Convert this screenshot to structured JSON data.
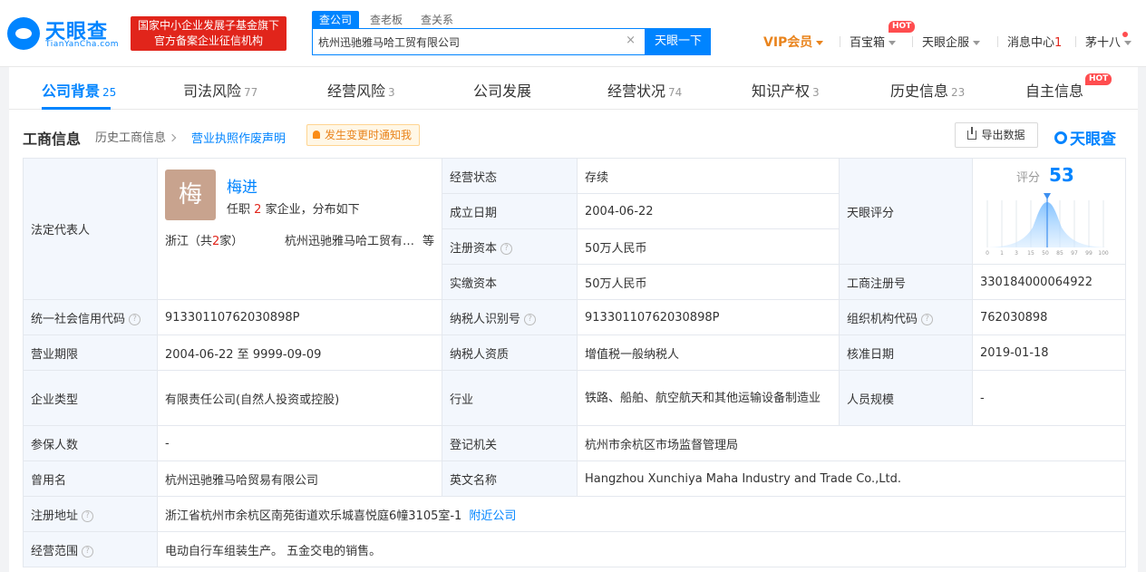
{
  "header": {
    "logo_text": "天眼查",
    "logo_sub": "TianYanCha.com",
    "gov_badge_line1": "国家中小企业发展子基金旗下",
    "gov_badge_line2": "官方备案企业征信机构",
    "search_tabs": [
      "查公司",
      "查老板",
      "查关系"
    ],
    "search_value": "杭州迅驰雅马哈工贸有限公司",
    "search_button": "天眼一下",
    "nav": {
      "vip": "VIP会员",
      "baibao": "百宝箱",
      "hot": "HOT",
      "enterprise": "天眼企服",
      "messages": "消息中心",
      "message_count": "1",
      "user": "茅十八"
    }
  },
  "tabs": [
    {
      "label": "公司背景",
      "count": "25"
    },
    {
      "label": "司法风险",
      "count": "77"
    },
    {
      "label": "经营风险",
      "count": "3"
    },
    {
      "label": "公司发展",
      "count": ""
    },
    {
      "label": "经营状况",
      "count": "74"
    },
    {
      "label": "知识产权",
      "count": "3"
    },
    {
      "label": "历史信息",
      "count": "23"
    },
    {
      "label": "自主信息",
      "count": ""
    }
  ],
  "tab_hot": "HOT",
  "section": {
    "title": "工商信息",
    "history_link": "历史工商信息",
    "declaration_link": "营业执照作废声明",
    "notify": "发生变更时通知我",
    "export": "导出数据",
    "brand": "天眼查"
  },
  "legal": {
    "label": "法定代表人",
    "avatar_char": "梅",
    "name": "梅进",
    "pos_prefix": "任职",
    "pos_count": "2",
    "pos_suffix": "家企业，分布如下",
    "prov_prefix": "浙江（共",
    "prov_count": "2",
    "prov_suffix": "家）",
    "company": "杭州迅驰雅马哈工贸有限公司",
    "etc": "等"
  },
  "score": {
    "label": "天眼评分",
    "title": "评分",
    "value": "53",
    "value_num": 53,
    "axis": [
      "0",
      "1",
      "3",
      "15",
      "50",
      "85",
      "97",
      "99",
      "100"
    ]
  },
  "rows": {
    "status_label": "经营状态",
    "status_value": "存续",
    "founded_label": "成立日期",
    "founded_value": "2004-06-22",
    "reg_capital_label": "注册资本",
    "reg_capital_value": "50万人民币",
    "paid_capital_label": "实缴资本",
    "paid_capital_value": "50万人民币",
    "reg_no_label": "工商注册号",
    "reg_no_value": "330184000064922",
    "credit_code_label": "统一社会信用代码",
    "credit_code_value": "91330110762030898P",
    "taxpayer_id_label": "纳税人识别号",
    "taxpayer_id_value": "91330110762030898P",
    "org_code_label": "组织机构代码",
    "org_code_value": "762030898",
    "term_label": "营业期限",
    "term_value": "2004-06-22 至 9999-09-09",
    "taxpayer_qual_label": "纳税人资质",
    "taxpayer_qual_value": "增值税一般纳税人",
    "approval_label": "核准日期",
    "approval_value": "2019-01-18",
    "type_label": "企业类型",
    "type_value": "有限责任公司(自然人投资或控股)",
    "industry_label": "行业",
    "industry_value": "铁路、船舶、航空航天和其他运输设备制造业",
    "staff_label": "人员规模",
    "staff_value": "-",
    "insured_label": "参保人数",
    "insured_value": "-",
    "authority_label": "登记机关",
    "authority_value": "杭州市余杭区市场监督管理局",
    "former_label": "曾用名",
    "former_value": "杭州迅驰雅马哈贸易有限公司",
    "english_label": "英文名称",
    "english_value": "Hangzhou Xunchiya Maha Industry and Trade Co.,Ltd.",
    "address_label": "注册地址",
    "address_value": "浙江省杭州市余杭区南苑街道欢乐城喜悦庭6幢3105室-1",
    "nearby": "附近公司",
    "scope_label": "经营范围",
    "scope_value": "电动自行车组装生产。 五金交电的销售。"
  },
  "colors": {
    "accent": "#0084ff",
    "red": "#e1251b",
    "vip": "#e9841d",
    "label_bg": "#f3f7fd"
  }
}
